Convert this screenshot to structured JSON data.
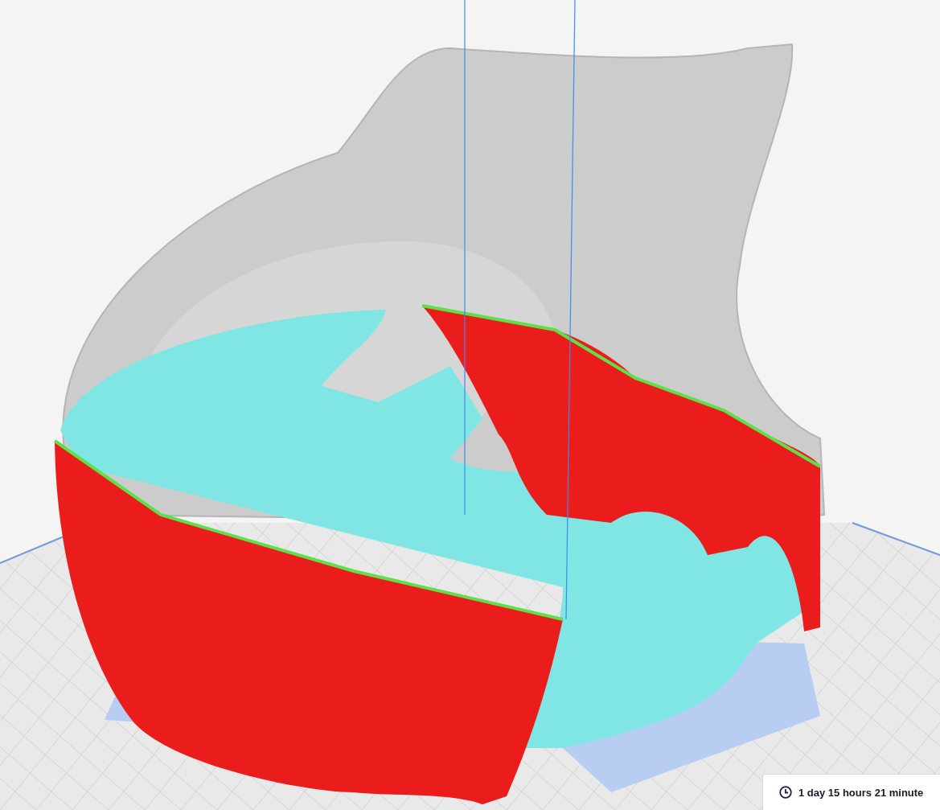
{
  "print_time": {
    "text": "1 day 15 hours 21 minute"
  }
}
